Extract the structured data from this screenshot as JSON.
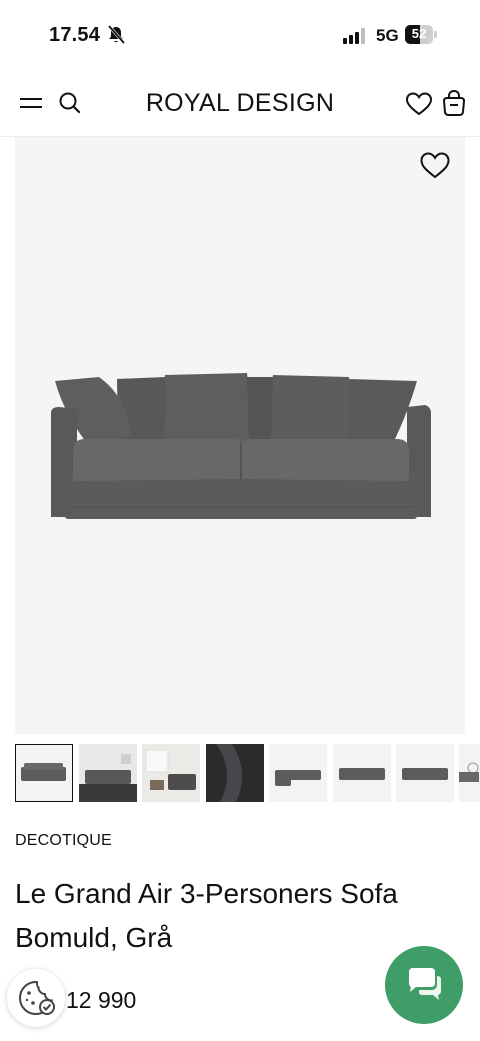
{
  "status_bar": {
    "time": "17.54",
    "network": "5G",
    "battery_level": "52"
  },
  "header": {
    "logo": "ROYAL DESIGN",
    "icons": [
      "menu-icon",
      "search-icon",
      "heart-icon",
      "shopping-bag-icon"
    ]
  },
  "product": {
    "brand": "DECOTIQUE",
    "title": "Le Grand Air 3-Personers Sofa Bomuld, Grå",
    "price": "12 990",
    "thumbnail_count": 8
  },
  "colors": {
    "chat_button": "#3f9e68",
    "hero_background": "#f5f5f5",
    "sofa": "#5f5d5b"
  }
}
